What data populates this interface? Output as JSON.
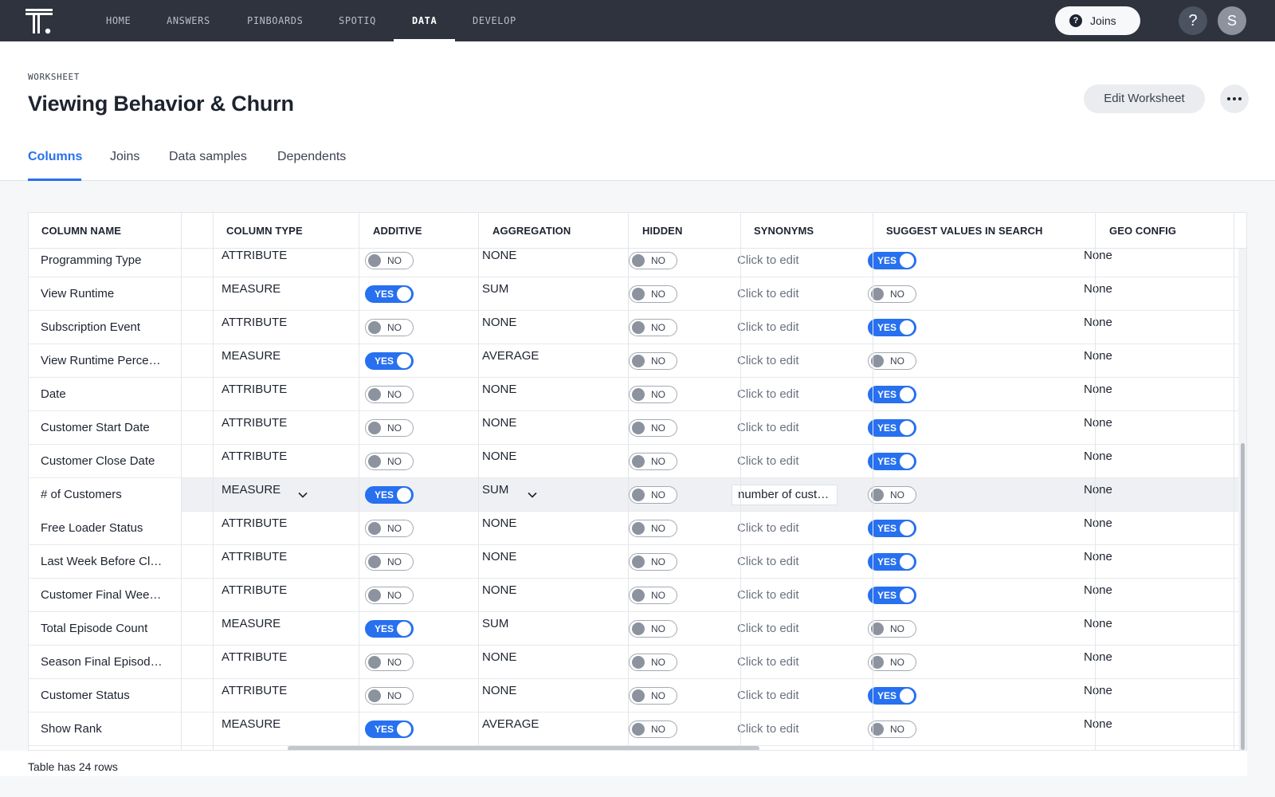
{
  "nav": {
    "items": [
      "HOME",
      "ANSWERS",
      "PINBOARDS",
      "SPOTIQ",
      "DATA",
      "DEVELOP"
    ],
    "active": "DATA",
    "joins_pill": "Joins",
    "help_glyph": "?",
    "avatar_initial": "S",
    "logo_icon": "thoughtspot-logo-icon",
    "colors": {
      "nav_bg": "#2e333d",
      "accent": "#2770ef"
    }
  },
  "header": {
    "subtitle": "WORKSHEET",
    "title": "Viewing Behavior & Churn",
    "edit_button": "Edit Worksheet",
    "more_icon": "more-horizontal-icon"
  },
  "tabs": [
    "Columns",
    "Joins",
    "Data samples",
    "Dependents"
  ],
  "table": {
    "headers": [
      "COLUMN NAME",
      "COLUMN TYPE",
      "ADDITIVE",
      "AGGREGATION",
      "HIDDEN",
      "SYNONYMS",
      "SUGGEST VALUES IN SEARCH",
      "GEO CONFIG"
    ],
    "rows": [
      {
        "name": "Programming Type",
        "type": "ATTRIBUTE",
        "additive": "NO",
        "aggregation": "NONE",
        "hidden": "NO",
        "synonyms": "Click to edit",
        "suggest": "YES",
        "geo": "None"
      },
      {
        "name": "View Runtime",
        "type": "MEASURE",
        "additive": "YES",
        "aggregation": "SUM",
        "hidden": "NO",
        "synonyms": "Click to edit",
        "suggest": "NO",
        "geo": "None"
      },
      {
        "name": "Subscription Event",
        "type": "ATTRIBUTE",
        "additive": "NO",
        "aggregation": "NONE",
        "hidden": "NO",
        "synonyms": "Click to edit",
        "suggest": "YES",
        "geo": "None"
      },
      {
        "name": "View Runtime Perce…",
        "type": "MEASURE",
        "additive": "YES",
        "aggregation": "AVERAGE",
        "hidden": "NO",
        "synonyms": "Click to edit",
        "suggest": "NO",
        "geo": "None"
      },
      {
        "name": "Date",
        "type": "ATTRIBUTE",
        "additive": "NO",
        "aggregation": "NONE",
        "hidden": "NO",
        "synonyms": "Click to edit",
        "suggest": "YES",
        "geo": "None"
      },
      {
        "name": "Customer Start Date",
        "type": "ATTRIBUTE",
        "additive": "NO",
        "aggregation": "NONE",
        "hidden": "NO",
        "synonyms": "Click to edit",
        "suggest": "YES",
        "geo": "None"
      },
      {
        "name": "Customer Close Date",
        "type": "ATTRIBUTE",
        "additive": "NO",
        "aggregation": "NONE",
        "hidden": "NO",
        "synonyms": "Click to edit",
        "suggest": "YES",
        "geo": "None"
      },
      {
        "name": "# of Customers",
        "type": "MEASURE",
        "additive": "YES",
        "aggregation": "SUM",
        "hidden": "NO",
        "synonyms": "number of cust…",
        "suggest": "NO",
        "geo": "None",
        "selected": true
      },
      {
        "name": "Free Loader Status",
        "type": "ATTRIBUTE",
        "additive": "NO",
        "aggregation": "NONE",
        "hidden": "NO",
        "synonyms": "Click to edit",
        "suggest": "YES",
        "geo": "None"
      },
      {
        "name": "Last Week Before Cl…",
        "type": "ATTRIBUTE",
        "additive": "NO",
        "aggregation": "NONE",
        "hidden": "NO",
        "synonyms": "Click to edit",
        "suggest": "YES",
        "geo": "None"
      },
      {
        "name": "Customer Final Wee…",
        "type": "ATTRIBUTE",
        "additive": "NO",
        "aggregation": "NONE",
        "hidden": "NO",
        "synonyms": "Click to edit",
        "suggest": "YES",
        "geo": "None"
      },
      {
        "name": "Total Episode Count",
        "type": "MEASURE",
        "additive": "YES",
        "aggregation": "SUM",
        "hidden": "NO",
        "synonyms": "Click to edit",
        "suggest": "NO",
        "geo": "None"
      },
      {
        "name": "Season Final Episod…",
        "type": "ATTRIBUTE",
        "additive": "NO",
        "aggregation": "NONE",
        "hidden": "NO",
        "synonyms": "Click to edit",
        "suggest": "NO",
        "geo": "None"
      },
      {
        "name": "Customer Status",
        "type": "ATTRIBUTE",
        "additive": "NO",
        "aggregation": "NONE",
        "hidden": "NO",
        "synonyms": "Click to edit",
        "suggest": "YES",
        "geo": "None"
      },
      {
        "name": "Show Rank",
        "type": "MEASURE",
        "additive": "YES",
        "aggregation": "AVERAGE",
        "hidden": "NO",
        "synonyms": "Click to edit",
        "suggest": "NO",
        "geo": "None"
      }
    ],
    "footer": "Table has 24 rows"
  }
}
